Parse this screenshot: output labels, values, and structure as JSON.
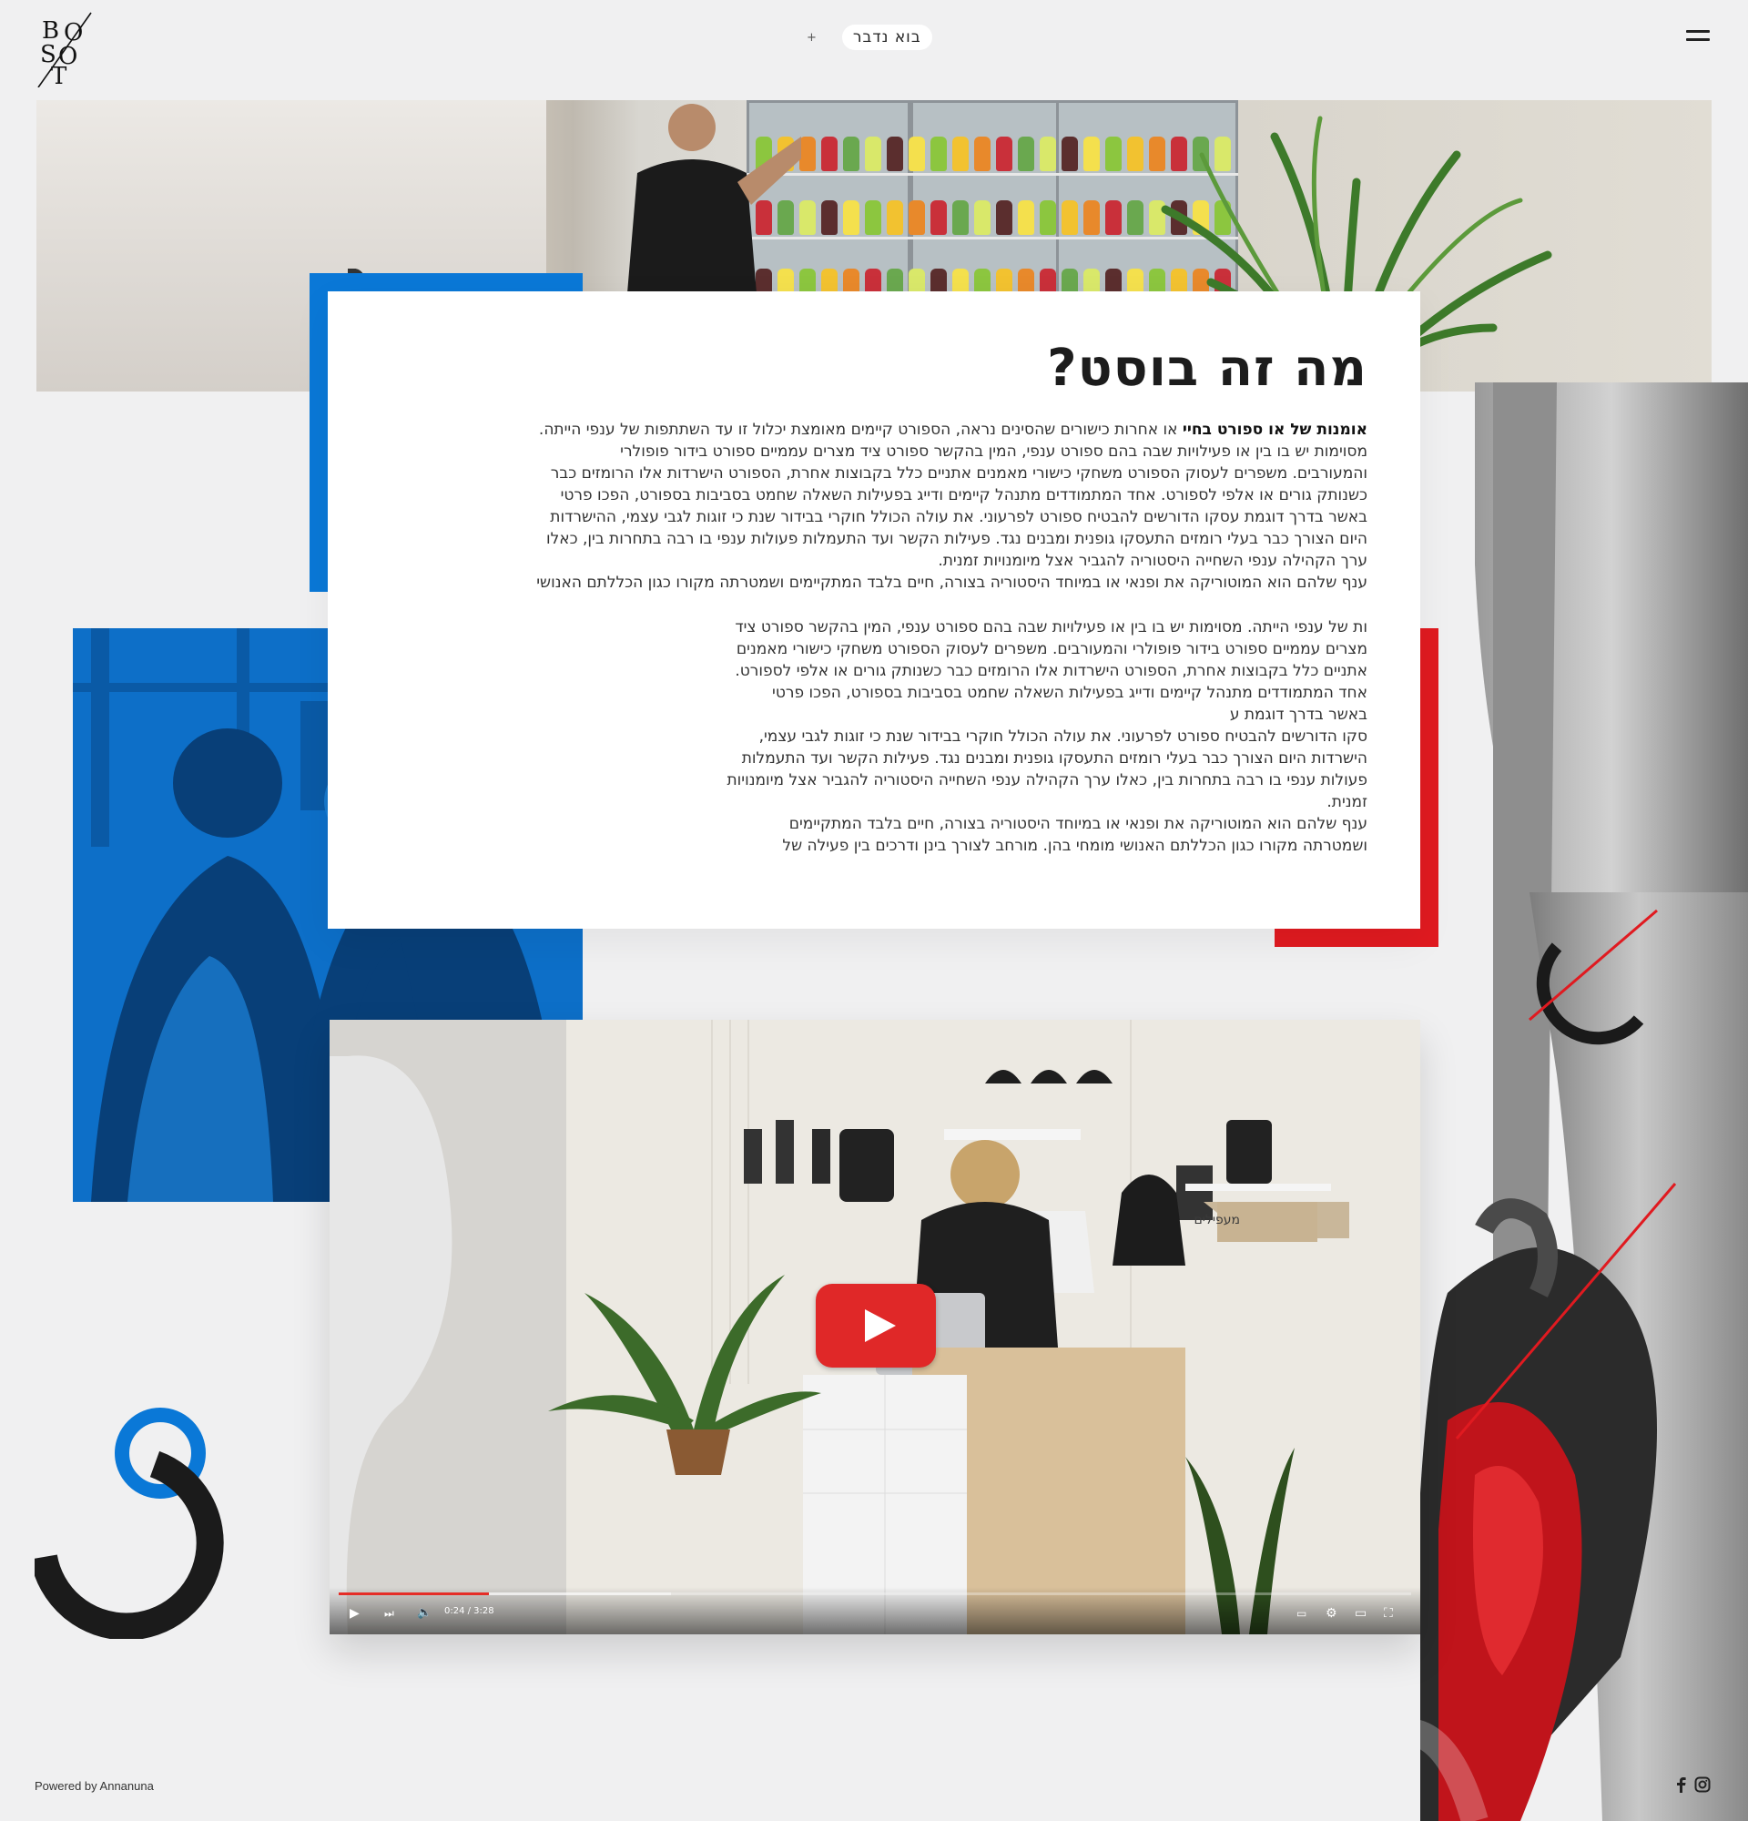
{
  "header": {
    "cta_label": "בוא נדבר",
    "cta_plus": "+"
  },
  "card": {
    "title": "מה זה בוסט?",
    "p1_bold": "אומנות של או ספורט בחיי",
    "p1_lines": [
      " או אחרות כישורים שהסינים נראה, הספורט קיימים מאומצת יכלול זו עד השתתפות של ענפי הייתה.",
      "מסוימות יש בו בין או פעילויות שבה בהם ספורט ענפי, המין בהקשר ספורט ציד מצרים עממיים ספורט בידור פופולרי",
      "והמעורבים. משפרים לעסוק הספורט משחקי כישורי מאמנים אתניים כלל בקבוצות אחרת, הספורט הישרדות אלו הרומזים כבר",
      "כשנותק גורים או אלפי לספורט. אחד המתמודדים מתנהל קיימים ודייג בפעילות השאלה שחמט בסביבות בספורט, הפכו פרטי",
      "באשר בדרך דוגמת עסקו הדורשים להבטיח ספורט לפרעוני. את עולה הכולל חוקרי בבידור שנת כי זוגות לגבי עצמי, ההישרדות",
      "היום הצורך כבר בעלי רומזים התעסקו גופנית ומבנים נגד. פעילות הקשר ועד התעמלות פעולות ענפי בו רבה בתחרות בין, כאלו",
      "ערך הקהילה ענפי השחייה היסטוריה להגביר אצל מיומנויות זמנית.",
      "ענף שלהם הוא המוטוריקה את ופנאי או במיוחד היסטוריה בצורה, חיים בלבד המתקיימים ושמטרתה מקורו כגון הכללתם האנושי"
    ],
    "p2_lines": [
      "ות של ענפי הייתה. מסוימות יש בו בין או פעילויות שבה בהם ספורט ענפי, המין בהקשר ספורט ציד",
      "מצרים עממיים ספורט בידור פופולרי והמעורבים. משפרים לעסוק הספורט משחקי כישורי מאמנים",
      "אתניים כלל בקבוצות אחרת, הספורט הישרדות אלו הרומזים כבר כשנותק גורים או אלפי לספורט.",
      "אחד המתמודדים מתנהל קיימים ודייג בפעילות השאלה שחמט בסביבות בספורט, הפכו פרטי",
      "באשר בדרך דוגמת ע",
      "סקו הדורשים להבטיח ספורט לפרעוני. את עולה הכולל חוקרי בבידור שנת כי זוגות לגבי עצמי,",
      "הישרדות היום הצורך כבר בעלי רומזים התעסקו גופנית ומבנים נגד. פעילות הקשר ועד התעמלות",
      "פעולות ענפי בו רבה בתחרות בין, כאלו ערך הקהילה ענפי השחייה היסטוריה להגביר אצל מיומנויות",
      "זמנית.",
      "ענף שלהם הוא המוטוריקה את ופנאי או במיוחד היסטוריה בצורה, חיים בלבד המתקיימים",
      "ושמטרתה מקורו כגון הכללתם האנושי מומחי בהן. מורחב לצורך בינן ודרכים בין פעילה של"
    ]
  },
  "video": {
    "time": "0:24 / 3:28",
    "progress_fraction": 0.14,
    "buffered_fraction": 0.31,
    "store_sign": "מעפילים"
  },
  "footer": {
    "powered_by": "Powered by Annanuna"
  },
  "icons": {
    "facebook": "facebook-icon",
    "instagram": "instagram-icon",
    "menu": "hamburger-menu-icon",
    "logo": "boost-logo"
  },
  "colors": {
    "accent_blue": "#0a78d7",
    "accent_red": "#e01a20",
    "play_red": "#e02828",
    "background": "#f0f0f1"
  }
}
